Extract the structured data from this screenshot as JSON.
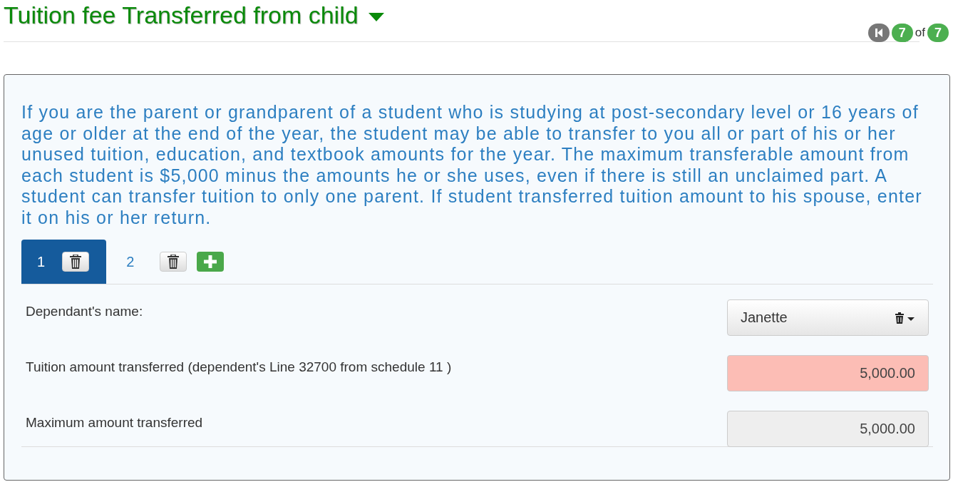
{
  "header": {
    "title": "Tuition fee Transferred from child",
    "pager": {
      "current": "7",
      "separator": "of",
      "total": "7"
    }
  },
  "panel": {
    "description": "If you are the parent or grandparent of a student who is studying at post-secondary level or 16 years of age or older at the end of the year, the student may be able to transfer to you all or part of his or her unused tuition, education, and textbook amounts for the year. The maximum transferable amount from each student is $5,000 minus the amounts he or she uses, even if there is still an unclaimed part. A student can transfer tuition to only one parent. If student transferred tuition amount to his spouse, enter it on his or her return.",
    "tabs": [
      {
        "label": "1",
        "selected": true
      },
      {
        "label": "2",
        "selected": false
      }
    ],
    "fields": [
      {
        "label": "Dependant's name:",
        "kind": "dropdown",
        "value": "Janette"
      },
      {
        "label": "Tuition amount transferred (dependent's Line 32700 from schedule 11 )",
        "kind": "error",
        "value": "5,000.00"
      },
      {
        "label": "Maximum amount transferred",
        "kind": "readonly",
        "value": "5,000.00"
      }
    ]
  }
}
